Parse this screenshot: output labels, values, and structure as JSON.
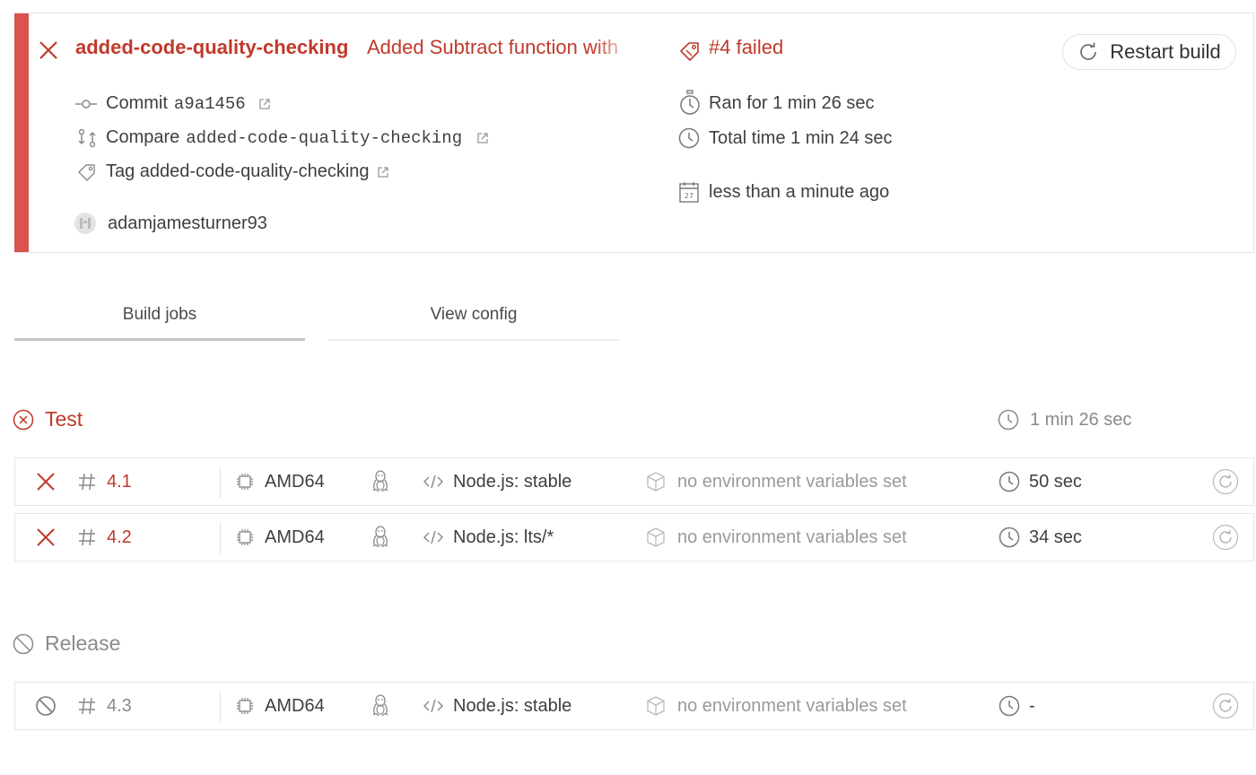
{
  "build": {
    "branch": "added-code-quality-checking",
    "commit_message": "Added Subtract function with",
    "commit_label": "Commit",
    "commit_sha": "a9a1456",
    "compare_label": "Compare",
    "compare_ref": "added-code-quality-checking",
    "tag_label": "Tag added-code-quality-checking",
    "author": "adamjamesturner93",
    "status": "#4 failed",
    "ran_for": "Ran for 1 min 26 sec",
    "total_time": "Total time 1 min 24 sec",
    "finished": "less than a minute ago",
    "calendar_day": "27",
    "restart_label": "Restart build",
    "accent_color": "#c0392b"
  },
  "tabs": [
    {
      "label": "Build jobs",
      "active": true
    },
    {
      "label": "View config",
      "active": false
    }
  ],
  "stages": [
    {
      "name": "Test",
      "duration": "1 min 26 sec",
      "status": "failed",
      "jobs": [
        {
          "number": "4.1",
          "arch": "AMD64",
          "os_icon": "linux-tux-icon",
          "language": "Node.js: stable",
          "env": "no environment variables set",
          "duration": "50 sec",
          "status": "failed"
        },
        {
          "number": "4.2",
          "arch": "AMD64",
          "os_icon": "linux-tux-icon",
          "language": "Node.js: lts/*",
          "env": "no environment variables set",
          "duration": "34 sec",
          "status": "failed"
        }
      ]
    },
    {
      "name": "Release",
      "duration": "",
      "status": "canceled",
      "jobs": [
        {
          "number": "4.3",
          "arch": "AMD64",
          "os_icon": "linux-tux-icon",
          "language": "Node.js: stable",
          "env": "no environment variables set",
          "duration": "-",
          "status": "canceled"
        }
      ]
    }
  ]
}
